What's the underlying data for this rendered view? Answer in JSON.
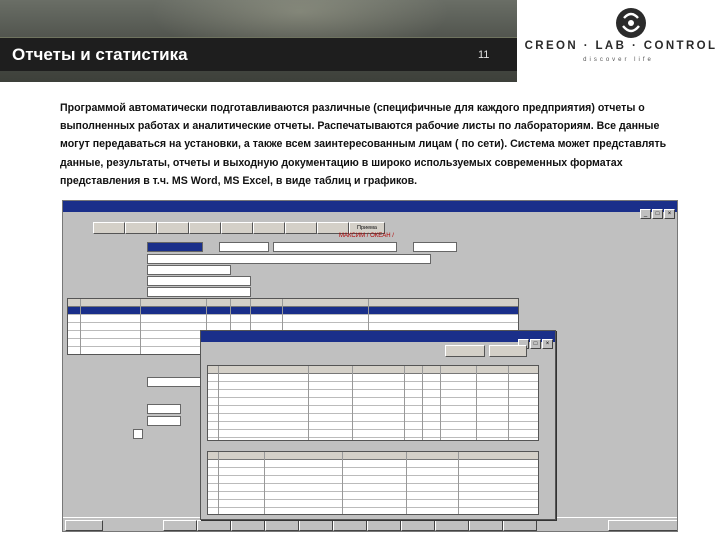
{
  "header": {
    "title": "Отчеты и статистика",
    "page_number": "11",
    "logo_text": "CREON · LAB · CONTROL",
    "logo_subtext": "discover life"
  },
  "body": {
    "paragraph": "Программой автоматически подготавливаются различные (специфичные для каждого предприятия) отчеты о выполненных работах и аналитические отчеты. Распечатываются рабочие листы по лабораториям. Все данные могут передаваться на установки, а также всем заинтересованным лицам ( по сети). Система может представлять данные, результаты, отчеты и выходную документацию в широко используемых современных форматах представления в т.ч. MS Word, MS Excel, в виде таблиц и графиков."
  },
  "colors": {
    "header_bg": "#4a4d47",
    "title_bar_bg": "#1e1e1e",
    "window_title_bg": "#1a2f8a",
    "window_chrome": "#c0c0c0",
    "accent_red": "#b00000"
  },
  "screenshot": {
    "visible_text": {
      "red_caption": "МАКСИМ / ОКЕАН /",
      "toolbar_button": "Приема"
    }
  }
}
